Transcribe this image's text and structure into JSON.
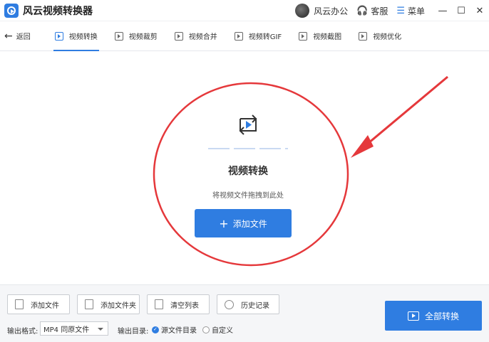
{
  "app": {
    "title": "风云视频转换器"
  },
  "titlebar": {
    "office_label": "风云办公",
    "service_label": "客服",
    "menu_label": "菜单",
    "minimize": "—",
    "maximize": "☐",
    "close": "✕"
  },
  "nav": {
    "back_label": "返回",
    "tabs": [
      {
        "label": "视频转换",
        "active": true
      },
      {
        "label": "视频裁剪"
      },
      {
        "label": "视频合并"
      },
      {
        "label": "视频转GIF"
      },
      {
        "label": "视频截图"
      },
      {
        "label": "视频优化"
      }
    ]
  },
  "main": {
    "title": "视频转换",
    "subtitle": "将视频文件拖拽到此处",
    "add_button_label": "添加文件",
    "add_button_plus": "+"
  },
  "bottom": {
    "buttons": [
      {
        "label": "添加文件"
      },
      {
        "label": "添加文件夹"
      },
      {
        "label": "清空列表"
      },
      {
        "label": "历史记录"
      }
    ],
    "format_label": "输出格式:",
    "format_value": "MP4 同原文件",
    "dir_label": "输出目录:",
    "dir_options": [
      {
        "label": "源文件目录",
        "checked": true
      },
      {
        "label": "自定义",
        "checked": false
      }
    ],
    "convert_all_label": "全部转换"
  },
  "colors": {
    "accent": "#2f7de1",
    "annotation": "#e5383b"
  }
}
